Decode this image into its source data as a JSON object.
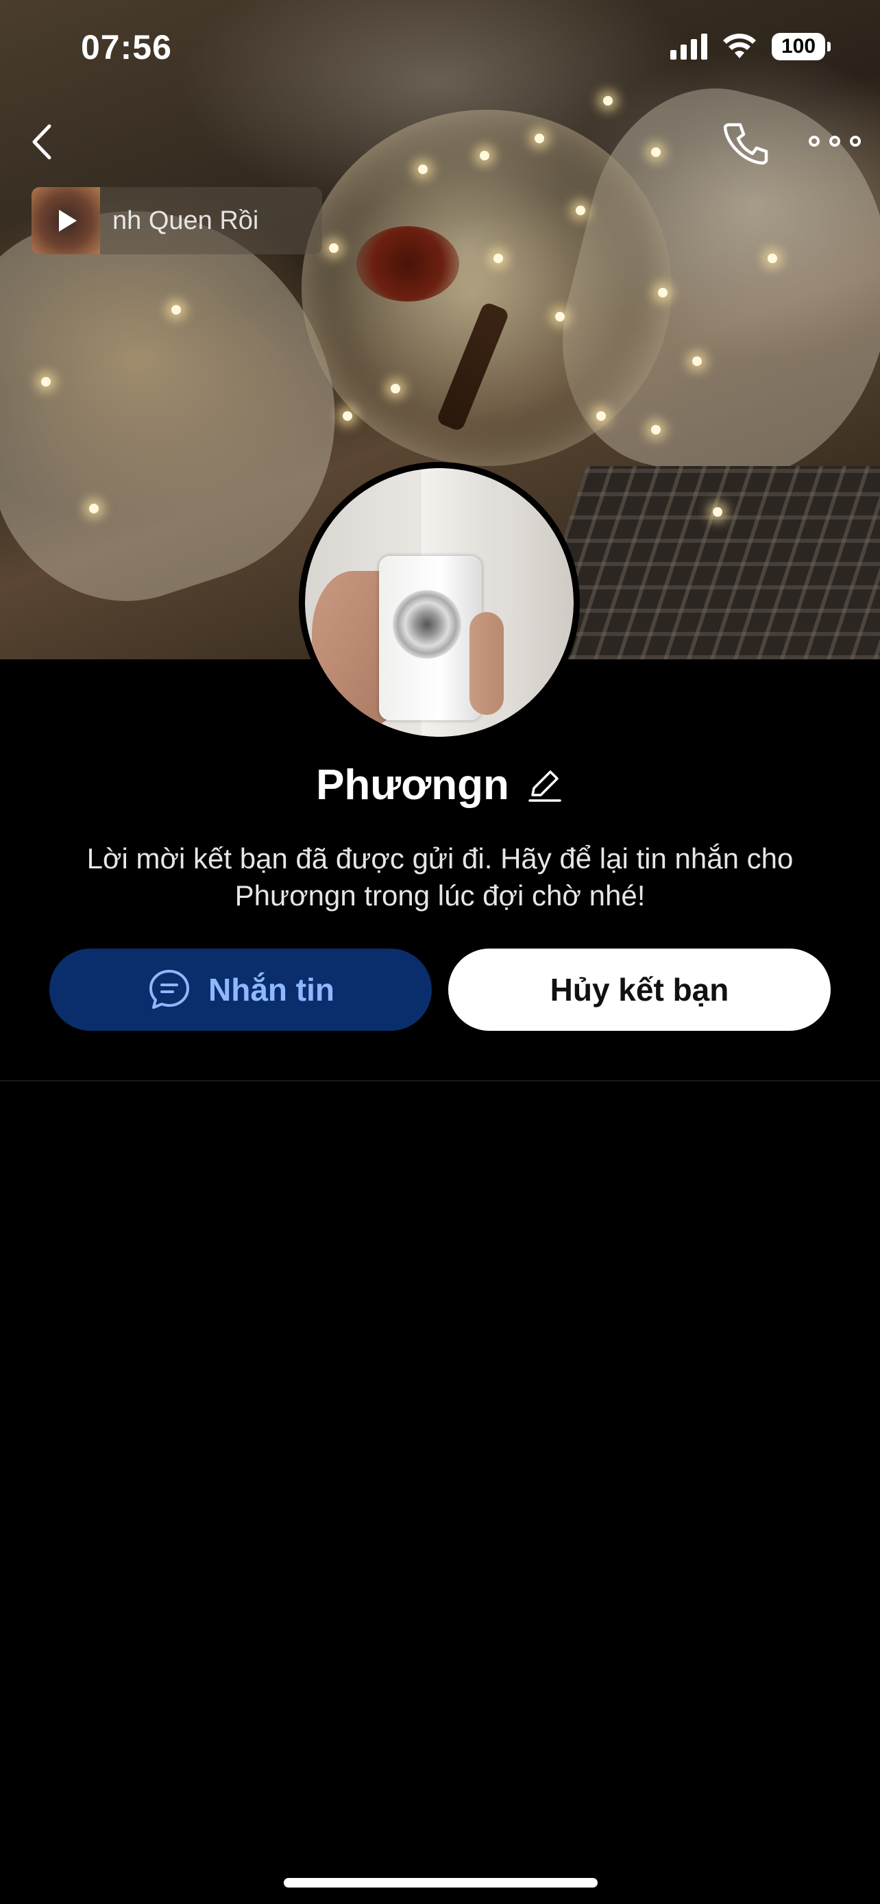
{
  "status_bar": {
    "time": "07:56",
    "battery": "100"
  },
  "nav": {
    "back_icon": "chevron-left-icon",
    "call_icon": "phone-icon",
    "more_icon": "more-horizontal-icon"
  },
  "music": {
    "title": "nh Quen Rồi",
    "play_icon": "play-icon"
  },
  "profile": {
    "name": "Phươngn",
    "edit_icon": "pencil-icon",
    "invite_message": "Lời mời kết bạn đã được gửi đi. Hãy để lại tin nhắn cho Phươngn trong lúc đợi chờ nhé!"
  },
  "actions": {
    "message_label": "Nhắn tin",
    "message_icon": "chat-bubble-icon",
    "unfriend_label": "Hủy kết bạn"
  },
  "colors": {
    "message_button_bg": "#0a2e6b",
    "message_button_text": "#8fb8ff",
    "unfriend_button_bg": "#ffffff",
    "background": "#000000"
  }
}
